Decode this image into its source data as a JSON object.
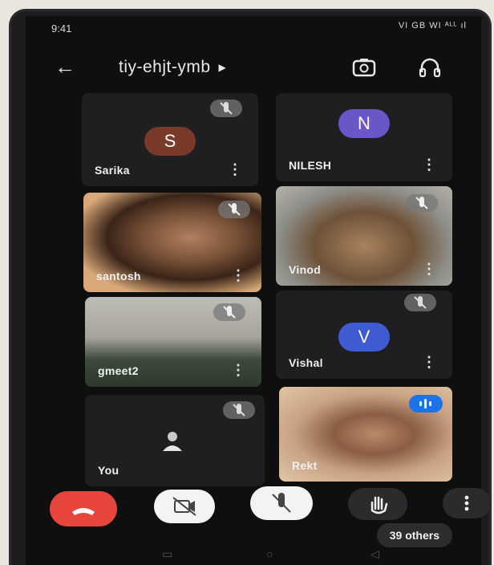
{
  "status": {
    "time": "9:41",
    "icons": "VI GB WI ᴬᴸᴸ ıl"
  },
  "meeting": {
    "code": "tiy-ehjt-ymb"
  },
  "participants": [
    {
      "name": "Sarika",
      "initial": "S",
      "avatar_color": "#7a3a2a"
    },
    {
      "name": "NILESH",
      "initial": "N",
      "avatar_color": "#6a56c8"
    },
    {
      "name": "santosh"
    },
    {
      "name": "Vinod"
    },
    {
      "name": "gmeet2"
    },
    {
      "name": "Vishal",
      "initial": "V",
      "avatar_color": "#3f5bd1"
    },
    {
      "name": "You"
    },
    {
      "name": "Rekt"
    }
  ],
  "others": {
    "label": "39 others"
  },
  "colors": {
    "end_call": "#e8453c",
    "speaking": "#1a73e8",
    "screen_bg": "#0f0f10"
  },
  "controls": {
    "end_call": "call-end-icon",
    "camera": "camera-off-icon",
    "mic": "mic-off-icon",
    "hand": "raise-hand-icon",
    "more": "more-vert-icon"
  }
}
